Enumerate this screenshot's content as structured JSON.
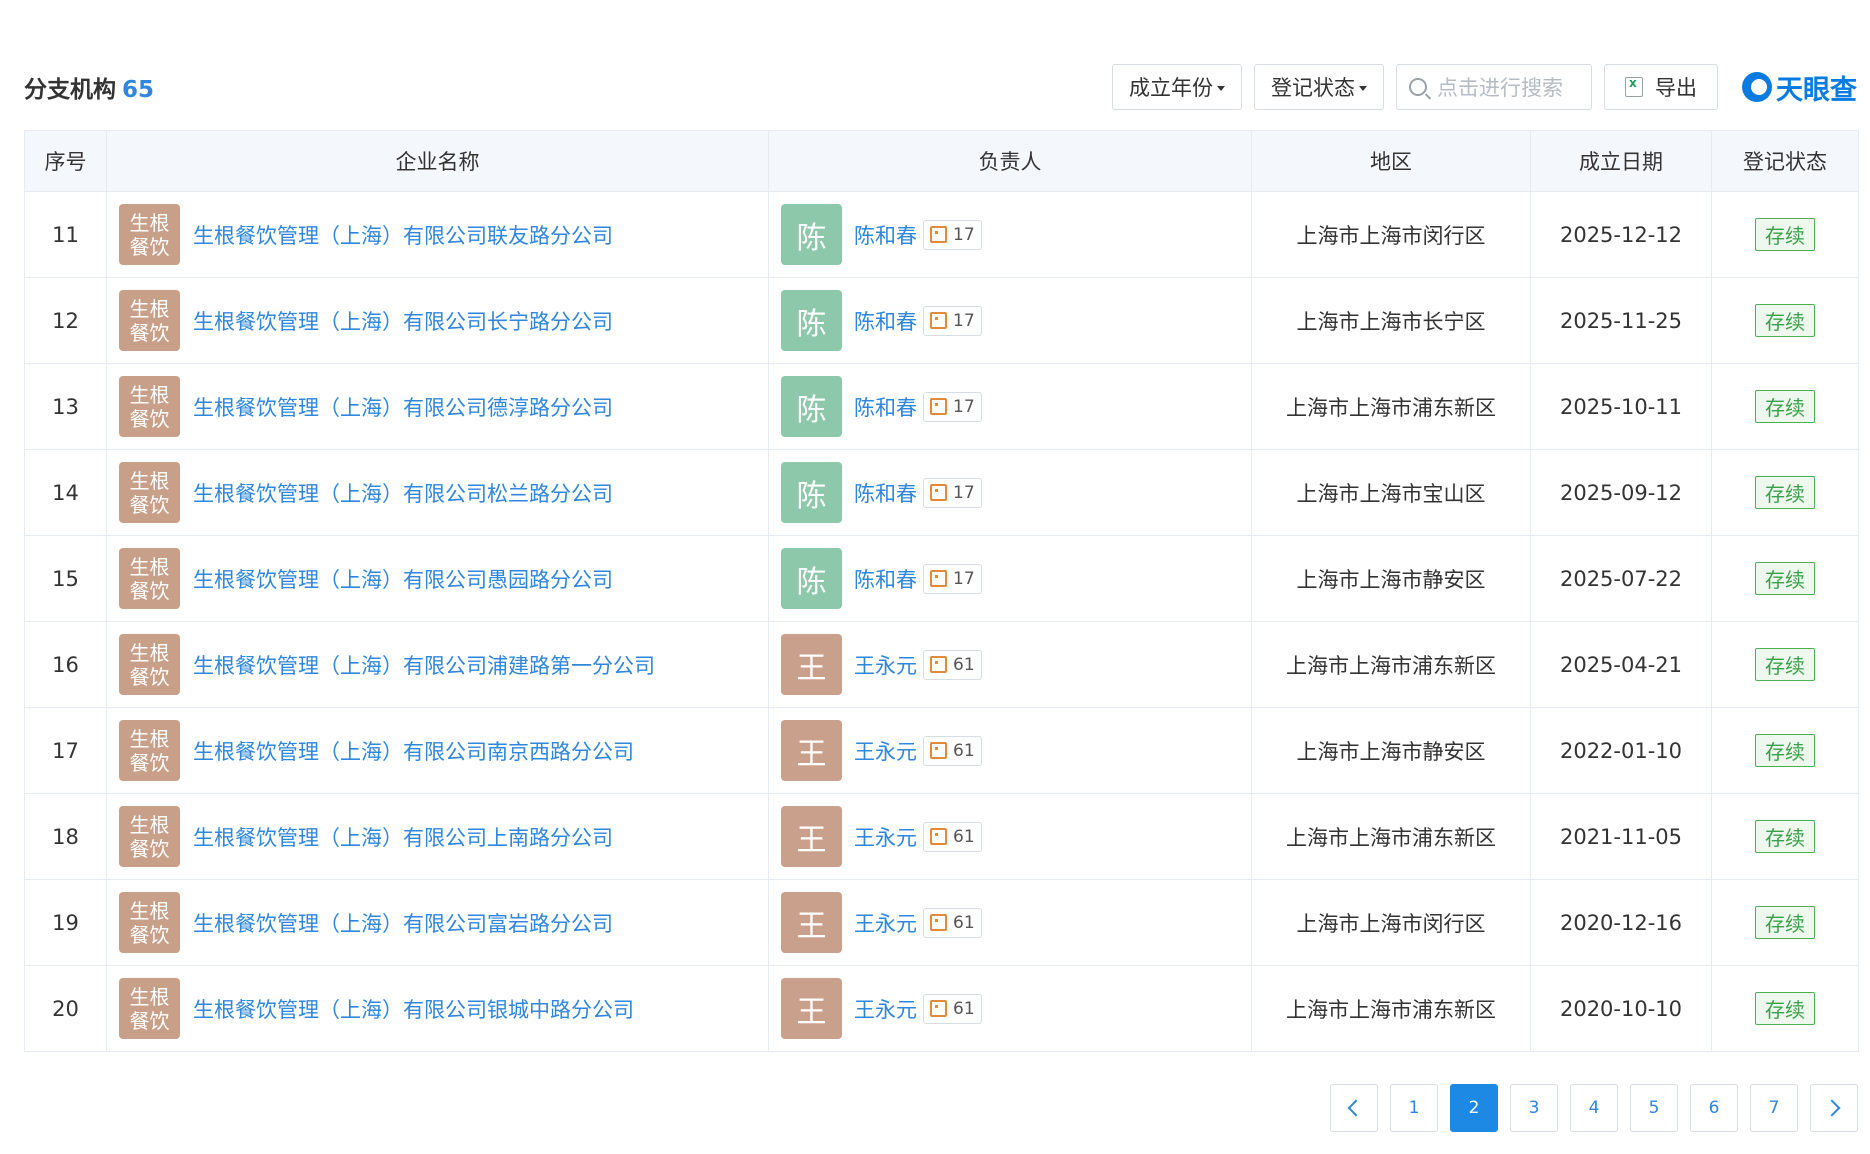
{
  "header": {
    "title": "分支机构",
    "count": "65",
    "filters": [
      {
        "label": "成立年份"
      },
      {
        "label": "登记状态"
      }
    ],
    "search_placeholder": "点击进行搜索",
    "export_label": "导出",
    "brand": "天眼查"
  },
  "table": {
    "columns": [
      "序号",
      "企业名称",
      "负责人",
      "地区",
      "成立日期",
      "登记状态"
    ],
    "logo_line1": "生根",
    "logo_line2": "餐饮",
    "rows": [
      {
        "no": "11",
        "company": "生根餐饮管理（上海）有限公司联友路分公司",
        "avatar": "陈",
        "avatar_color": "#8cc8a9",
        "person": "陈和春",
        "relations": "17",
        "region": "上海市上海市闵行区",
        "date": "2025-12-12",
        "status": "存续"
      },
      {
        "no": "12",
        "company": "生根餐饮管理（上海）有限公司长宁路分公司",
        "avatar": "陈",
        "avatar_color": "#8cc8a9",
        "person": "陈和春",
        "relations": "17",
        "region": "上海市上海市长宁区",
        "date": "2025-11-25",
        "status": "存续"
      },
      {
        "no": "13",
        "company": "生根餐饮管理（上海）有限公司德淳路分公司",
        "avatar": "陈",
        "avatar_color": "#8cc8a9",
        "person": "陈和春",
        "relations": "17",
        "region": "上海市上海市浦东新区",
        "date": "2025-10-11",
        "status": "存续"
      },
      {
        "no": "14",
        "company": "生根餐饮管理（上海）有限公司松兰路分公司",
        "avatar": "陈",
        "avatar_color": "#8cc8a9",
        "person": "陈和春",
        "relations": "17",
        "region": "上海市上海市宝山区",
        "date": "2025-09-12",
        "status": "存续"
      },
      {
        "no": "15",
        "company": "生根餐饮管理（上海）有限公司愚园路分公司",
        "avatar": "陈",
        "avatar_color": "#8cc8a9",
        "person": "陈和春",
        "relations": "17",
        "region": "上海市上海市静安区",
        "date": "2025-07-22",
        "status": "存续"
      },
      {
        "no": "16",
        "company": "生根餐饮管理（上海）有限公司浦建路第一分公司",
        "avatar": "王",
        "avatar_color": "#c9a08c",
        "person": "王永元",
        "relations": "61",
        "region": "上海市上海市浦东新区",
        "date": "2025-04-21",
        "status": "存续"
      },
      {
        "no": "17",
        "company": "生根餐饮管理（上海）有限公司南京西路分公司",
        "avatar": "王",
        "avatar_color": "#c9a08c",
        "person": "王永元",
        "relations": "61",
        "region": "上海市上海市静安区",
        "date": "2022-01-10",
        "status": "存续"
      },
      {
        "no": "18",
        "company": "生根餐饮管理（上海）有限公司上南路分公司",
        "avatar": "王",
        "avatar_color": "#c9a08c",
        "person": "王永元",
        "relations": "61",
        "region": "上海市上海市浦东新区",
        "date": "2021-11-05",
        "status": "存续"
      },
      {
        "no": "19",
        "company": "生根餐饮管理（上海）有限公司富岩路分公司",
        "avatar": "王",
        "avatar_color": "#c9a08c",
        "person": "王永元",
        "relations": "61",
        "region": "上海市上海市闵行区",
        "date": "2020-12-16",
        "status": "存续"
      },
      {
        "no": "20",
        "company": "生根餐饮管理（上海）有限公司银城中路分公司",
        "avatar": "王",
        "avatar_color": "#c9a08c",
        "person": "王永元",
        "relations": "61",
        "region": "上海市上海市浦东新区",
        "date": "2020-10-10",
        "status": "存续"
      }
    ]
  },
  "pagination": {
    "pages": [
      "1",
      "2",
      "3",
      "4",
      "5",
      "6",
      "7"
    ],
    "current": "2"
  },
  "colors": {
    "link": "#2e86de",
    "active_page": "#1e88e5",
    "status_green": "#3aa14a"
  }
}
